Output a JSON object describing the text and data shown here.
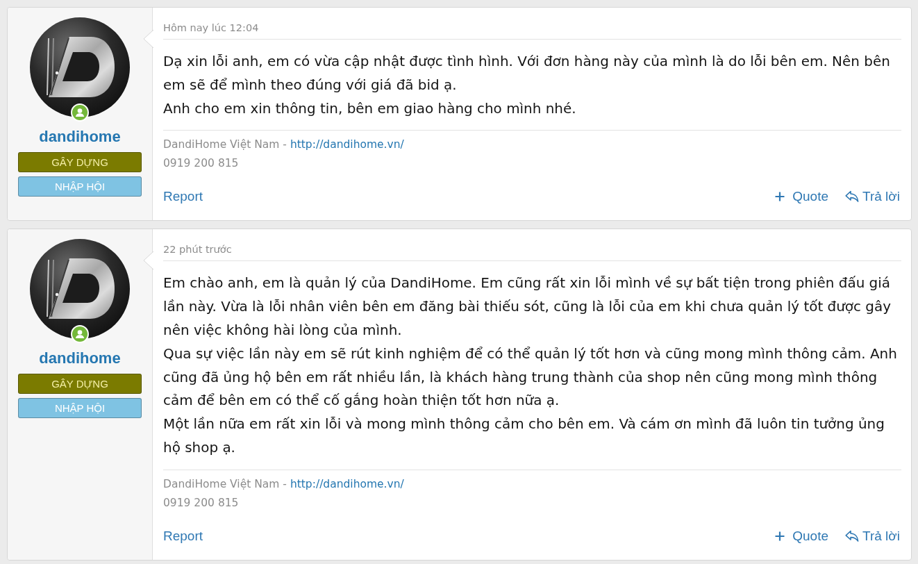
{
  "posts": [
    {
      "author": {
        "username": "dandihome",
        "online": true,
        "banners": [
          {
            "text": "GÂY DỰNG",
            "color": "#7b7b00"
          },
          {
            "text": "NHẬP HỘI",
            "color": "#7fc3e3"
          }
        ]
      },
      "timestamp": "Hôm nay lúc 12:04",
      "paragraphs": [
        "Dạ xin lỗi anh, em có vừa cập nhật được tình hình. Với đơn hàng này của mình là do lỗi bên em. Nên bên em sẽ để mình theo đúng với giá đã bid ạ.",
        "Anh cho em xin thông tin, bên em giao hàng cho mình nhé."
      ],
      "signature": {
        "text": "DandiHome Việt Nam -",
        "link": "http://dandihome.vn/",
        "phone": "0919 200 815"
      },
      "actions": {
        "report": "Report",
        "quote": "Quote",
        "reply": "Trả lời"
      }
    },
    {
      "author": {
        "username": "dandihome",
        "online": true,
        "banners": [
          {
            "text": "GÂY DỰNG",
            "color": "#7b7b00"
          },
          {
            "text": "NHẬP HỘI",
            "color": "#7fc3e3"
          }
        ]
      },
      "timestamp": "22 phút trước",
      "paragraphs": [
        "Em chào anh, em là quản lý của DandiHome. Em cũng rất xin lỗi mình về sự bất tiện trong phiên đấu giá lần này. Vừa là lỗi nhân viên bên em đăng bài thiếu sót, cũng là lỗi của em khi chưa quản lý tốt được gây nên việc không hài lòng của mình.",
        "Qua sự việc lần này em sẽ rút kinh nghiệm để có thể quản lý tốt hơn và cũng mong mình thông cảm. Anh cũng đã ủng hộ bên em rất nhiều lần, là khách hàng trung thành của shop nên cũng mong mình thông cảm để bên em có thể cố gắng hoàn thiện tốt hơn nữa ạ.",
        "Một lần nữa em rất xin lỗi và mong mình thông cảm cho bên em. Và cám ơn mình đã luôn tin tưởng ủng hộ shop ạ."
      ],
      "signature": {
        "text": "DandiHome Việt Nam -",
        "link": "http://dandihome.vn/",
        "phone": "0919 200 815"
      },
      "actions": {
        "report": "Report",
        "quote": "Quote",
        "reply": "Trả lời"
      }
    }
  ]
}
